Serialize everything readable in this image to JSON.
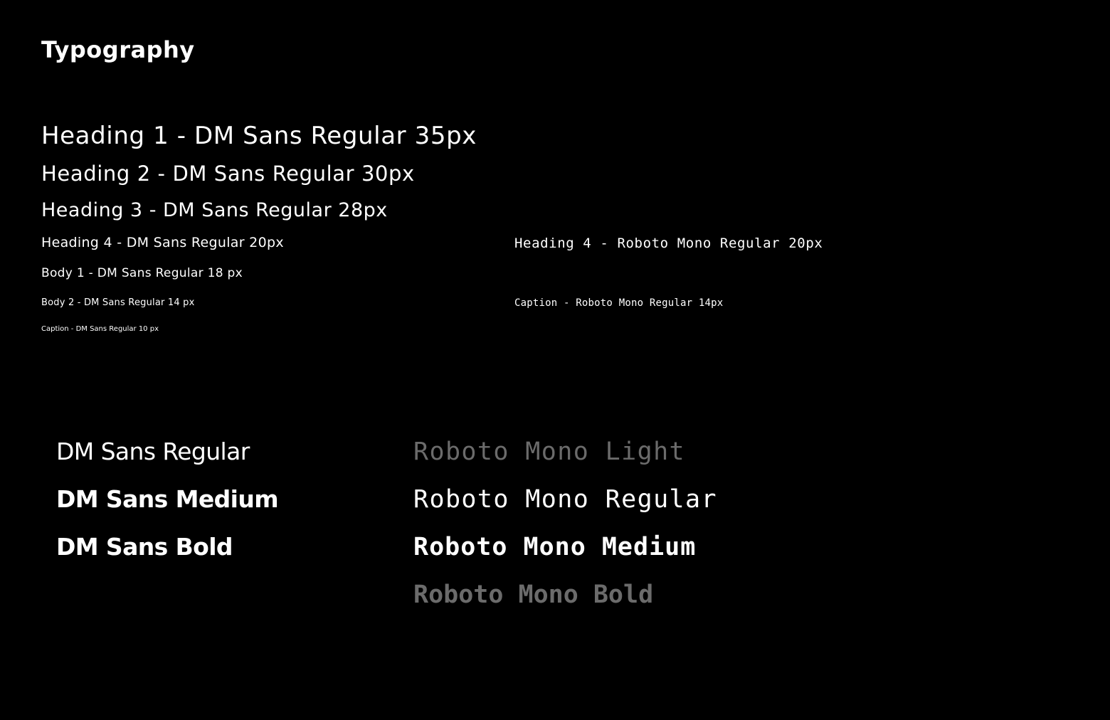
{
  "page": {
    "title": "Typography",
    "background": "#000000"
  },
  "sans_scale": {
    "heading1": "Heading 1 - DM Sans Regular 35px",
    "heading2": "Heading 2 - DM Sans Regular 30px",
    "heading3": "Heading 3 - DM Sans Regular 28px",
    "heading4": "Heading 4 - DM Sans Regular 20px",
    "body1": "Body 1 - DM Sans Regular 18 px",
    "body2": "Body 2 - DM Sans Regular 14 px",
    "caption": "Caption - DM Sans Regular 10 px"
  },
  "mono_scale": {
    "heading4": "Heading 4 - Roboto Mono Regular 20px",
    "caption": "Caption - Roboto Mono Regular 14px"
  },
  "sans_weights": {
    "regular": "DM Sans Regular",
    "medium": "DM Sans Medium",
    "bold": "DM Sans Bold"
  },
  "mono_weights": {
    "light": "Roboto Mono Light",
    "regular": "Roboto Mono Regular",
    "medium": "Roboto Mono Medium",
    "bold": "Roboto Mono Bold"
  },
  "colors": {
    "text_primary": "#ffffff",
    "text_muted": "#6b6b6b"
  }
}
